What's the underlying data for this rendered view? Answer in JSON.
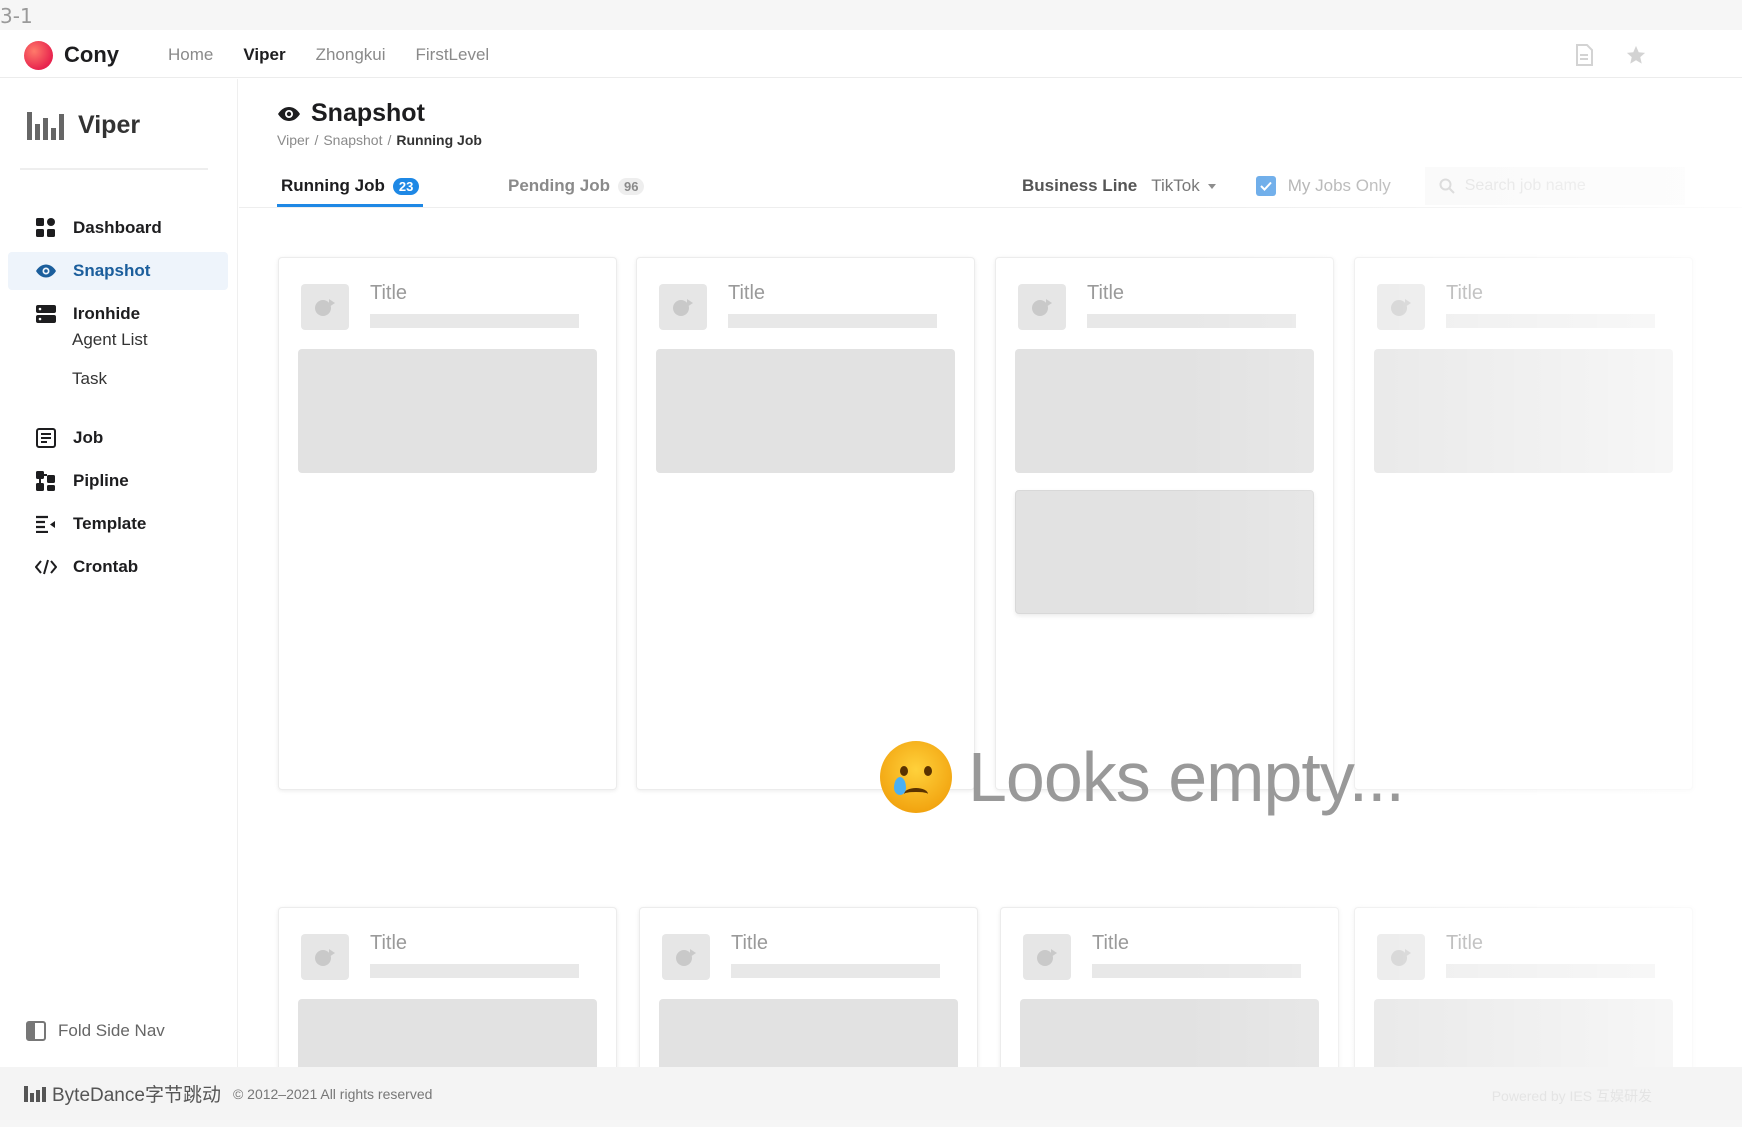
{
  "frame_label": "3-1",
  "topbar": {
    "brand": "Cony",
    "nav": [
      {
        "label": "Home",
        "active": false
      },
      {
        "label": "Viper",
        "active": true
      },
      {
        "label": "Zhongkui",
        "active": false
      },
      {
        "label": "FirstLevel",
        "active": false
      }
    ]
  },
  "sidebar": {
    "brand": "Viper",
    "items": [
      {
        "label": "Dashboard",
        "icon": "dashboard-icon",
        "active": false
      },
      {
        "label": "Snapshot",
        "icon": "eye-icon",
        "active": true
      },
      {
        "label": "Ironhide",
        "icon": "server-icon",
        "active": false
      },
      {
        "label": "Job",
        "icon": "job-icon",
        "active": false
      },
      {
        "label": "Pipline",
        "icon": "pipeline-icon",
        "active": false
      },
      {
        "label": "Template",
        "icon": "template-icon",
        "active": false
      },
      {
        "label": "Crontab",
        "icon": "code-icon",
        "active": false
      }
    ],
    "subitems": [
      "Agent List",
      "Task"
    ],
    "fold_label": "Fold Side Nav"
  },
  "page": {
    "title": "Snapshot",
    "breadcrumb": [
      "Viper",
      "Snapshot",
      "Running Job"
    ],
    "tabs": [
      {
        "label": "Running Job",
        "count": "23",
        "active": true
      },
      {
        "label": "Pending Job",
        "count": "96",
        "active": false
      }
    ],
    "business_line_label": "Business Line",
    "business_line_value": "TikTok",
    "my_jobs_only_label": "My Jobs Only",
    "my_jobs_only_checked": true,
    "search_placeholder": "Search job name"
  },
  "cards": {
    "title": "Title",
    "row1": [
      "Title",
      "Title",
      "Title",
      "Title"
    ],
    "row2": [
      "Title",
      "Title",
      "Title",
      "Title"
    ]
  },
  "empty_state": {
    "emoji": "crying-face",
    "message": "Looks empty..."
  },
  "footer": {
    "brand": "ByteDance字节跳动",
    "copyright": "© 2012–2021 All rights reserved",
    "powered": "Powered by IES 互娱研发"
  },
  "colors": {
    "accent": "#1e88e5",
    "active_nav_bg": "#eef4fb",
    "active_nav_text": "#1b5e9c",
    "brand_logo": "#e8244e"
  }
}
